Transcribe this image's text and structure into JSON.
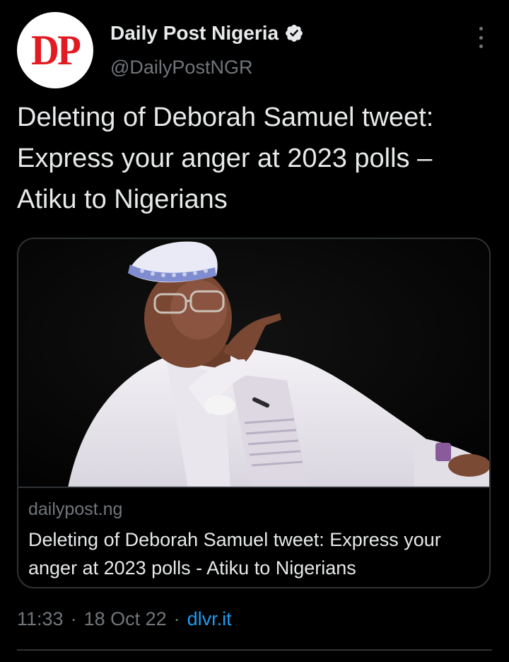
{
  "author": {
    "avatar_text": "DP",
    "display_name": "Daily Post Nigeria",
    "handle": "@DailyPostNGR",
    "verified_icon": "verified-badge-icon"
  },
  "tweet": {
    "text": "Deleting of Deborah Samuel tweet: Express your anger at 2023 polls – Atiku to Nigerians"
  },
  "card": {
    "image_icon": "article-photo",
    "domain": "dailypost.ng",
    "title": "Deleting of Deborah Samuel tweet: Express your anger at 2023 polls - Atiku to Nigerians"
  },
  "meta": {
    "time": "11:33",
    "separator_1": "·",
    "date": "18 Oct 22",
    "separator_2": "·",
    "source": "dlvr.it"
  },
  "colors": {
    "background": "#000000",
    "text_primary": "#e7e9ea",
    "text_secondary": "#71767b",
    "link": "#1d9bf0",
    "border": "#2f3336",
    "avatar_red": "#e21b22"
  }
}
